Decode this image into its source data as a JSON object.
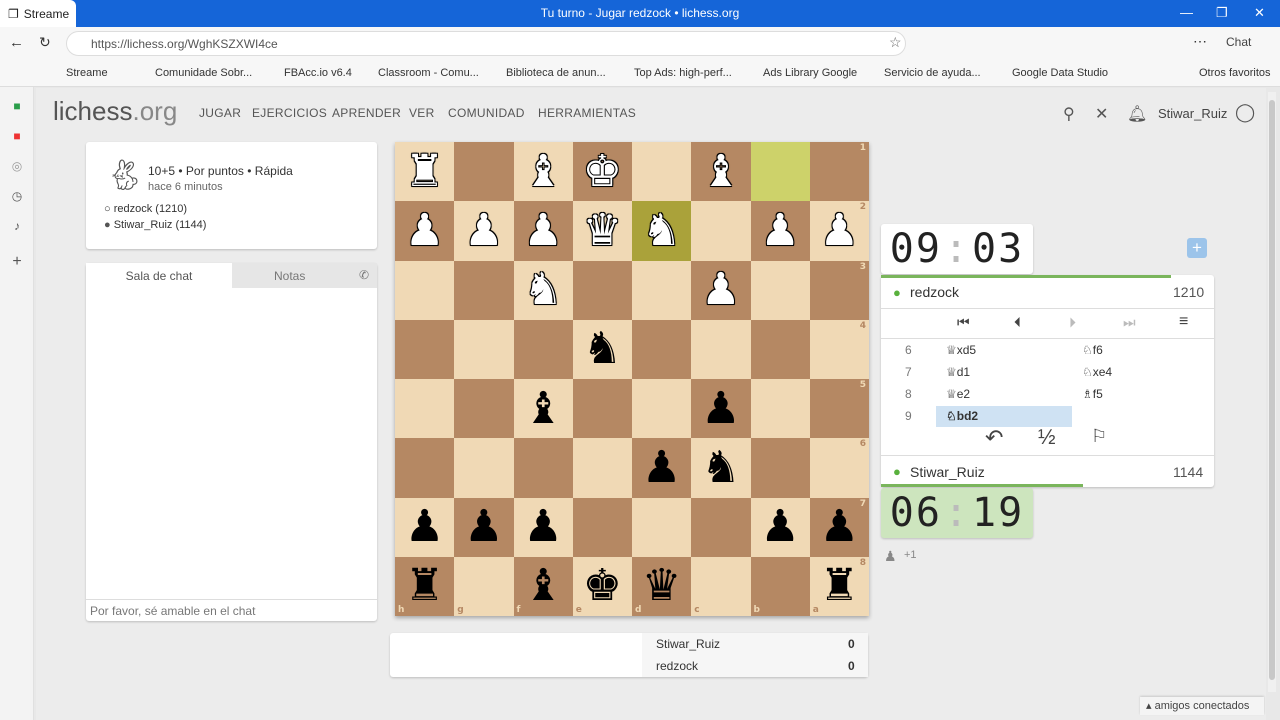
{
  "browser": {
    "tab_label": "Streame",
    "window_title": "Tu turno - Jugar redzock • lichess.org",
    "url": "https://lichess.org/WghKSZXWI4ce",
    "copilot": "Chat"
  },
  "bookmarks": [
    "Streame",
    "Comunidade Sobr...",
    "FBAcc.io v6.4",
    "Classroom - Comu...",
    "Biblioteca de anun...",
    "Top Ads: high-perf...",
    "Ads Library Google",
    "Servicio de ayuda...",
    "Google Data Studio",
    "Otros favoritos"
  ],
  "site": {
    "logo": "lichess",
    "logo_tld": ".org",
    "nav": [
      "JUGAR",
      "EJERCICIOS",
      "APRENDER",
      "VER",
      "COMUNIDAD",
      "HERRAMIENTAS"
    ],
    "username": "Stiwar_Ruiz"
  },
  "game": {
    "mode": "10+5 • Por puntos • Rápida",
    "ago": "hace 6 minutos",
    "white": "redzock (1210)",
    "black": "Stiwar_Ruiz (1144)"
  },
  "chat": {
    "tab_chat": "Sala de chat",
    "tab_notes": "Notas",
    "placeholder": "Por favor, sé amable en el chat"
  },
  "board": {
    "ranks": [
      "1",
      "2",
      "3",
      "4",
      "5",
      "6",
      "7",
      "8"
    ],
    "files": [
      "h",
      "g",
      "f",
      "e",
      "d",
      "c",
      "b",
      "a"
    ],
    "rows": [
      [
        "wR",
        "",
        "wB",
        "wK",
        "",
        "wB",
        "",
        ""
      ],
      [
        "wP",
        "wP",
        "wP",
        "wQ",
        "wN",
        "",
        "wP",
        "wP"
      ],
      [
        "",
        "",
        "wN",
        "",
        "",
        "wP",
        "",
        ""
      ],
      [
        "",
        "",
        "",
        "bN",
        "",
        "",
        "",
        ""
      ],
      [
        "",
        "",
        "bB",
        "",
        "",
        "bP",
        "",
        ""
      ],
      [
        "",
        "",
        "",
        "",
        "bP",
        "bN",
        "",
        ""
      ],
      [
        "bP",
        "bP",
        "bP",
        "",
        "",
        "",
        "bP",
        "bP"
      ],
      [
        "bR",
        "",
        "bB",
        "bK",
        "bQ",
        "",
        "",
        "bR"
      ]
    ],
    "last_move": [
      "e2",
      "b1"
    ]
  },
  "clocks": {
    "top": {
      "min": "09",
      "sec": "03"
    },
    "bottom": {
      "min": "06",
      "sec": "19"
    }
  },
  "players": {
    "top": {
      "name": "redzock",
      "rating": "1210"
    },
    "bottom": {
      "name": "Stiwar_Ruiz",
      "rating": "1144"
    }
  },
  "moves": [
    {
      "n": "6",
      "w": "♕xd5",
      "b": "♘f6"
    },
    {
      "n": "7",
      "w": "♕d1",
      "b": "♘xe4"
    },
    {
      "n": "8",
      "w": "♕e2",
      "b": "♗f5"
    },
    {
      "n": "9",
      "w": "♘bd2",
      "b": ""
    }
  ],
  "controls": {
    "draw": "½",
    "plus": "+1"
  },
  "crosstable": [
    {
      "name": "Stiwar_Ruiz",
      "score": "0"
    },
    {
      "name": "redzock",
      "score": "0"
    }
  ],
  "footer": {
    "friends": "amigos conectados"
  }
}
